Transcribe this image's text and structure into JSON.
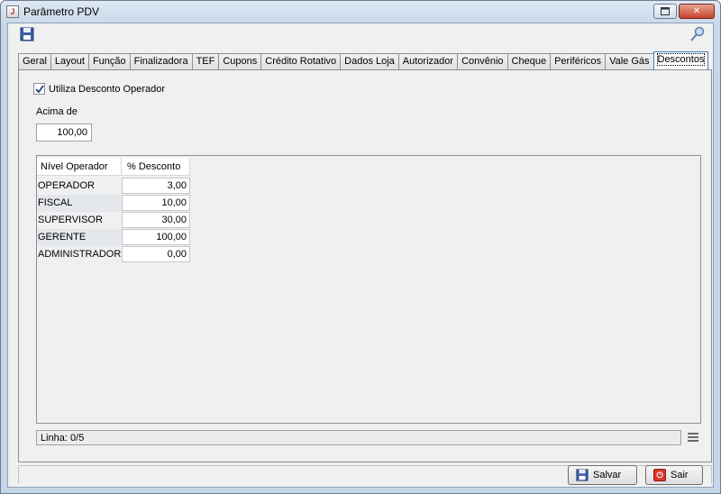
{
  "window": {
    "title": "Parâmetro PDV"
  },
  "tabs": [
    {
      "label": "Geral"
    },
    {
      "label": "Layout"
    },
    {
      "label": "Função"
    },
    {
      "label": "Finalizadora"
    },
    {
      "label": "TEF"
    },
    {
      "label": "Cupons"
    },
    {
      "label": "Crédito Rotativo"
    },
    {
      "label": "Dados Loja"
    },
    {
      "label": "Autorizador"
    },
    {
      "label": "Convênio"
    },
    {
      "label": "Cheque"
    },
    {
      "label": "Periféricos"
    },
    {
      "label": "Vale Gás"
    },
    {
      "label": "Descontos",
      "active": true
    }
  ],
  "descontos": {
    "checkbox_label": "Utiliza Desconto Operador",
    "checkbox_checked": true,
    "acima_label": "Acima de",
    "acima_value": "100,00",
    "grid": {
      "columns": [
        "Nível Operador",
        "% Desconto"
      ],
      "rows": [
        {
          "nivel": "OPERADOR",
          "desconto": "3,00"
        },
        {
          "nivel": "FISCAL",
          "desconto": "10,00"
        },
        {
          "nivel": "SUPERVISOR",
          "desconto": "30,00"
        },
        {
          "nivel": "GERENTE",
          "desconto": "100,00"
        },
        {
          "nivel": "ADMINISTRADOR",
          "desconto": "0,00"
        }
      ]
    },
    "status_text": "Linha: 0/5"
  },
  "buttons": {
    "save": "Salvar",
    "exit": "Sair"
  },
  "icons": {
    "app": "java-app-icon",
    "save_toolbar": "floppy-disk-icon",
    "search": "key-search-icon",
    "menu": "hamburger-icon",
    "exit": "power-icon"
  }
}
